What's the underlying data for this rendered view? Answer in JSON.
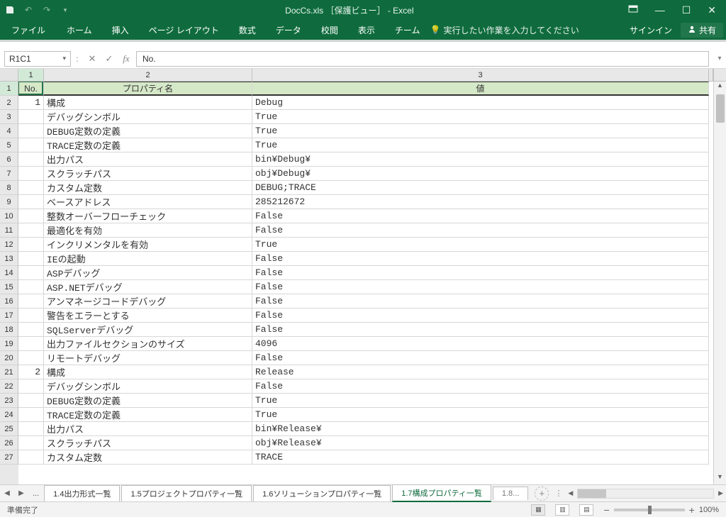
{
  "title": "DocCs.xls ［保護ビュー］ - Excel",
  "ribbon": {
    "file": "ファイル",
    "tabs": [
      "ホーム",
      "挿入",
      "ページ レイアウト",
      "数式",
      "データ",
      "校閲",
      "表示",
      "チーム"
    ],
    "tellme": "実行したい作業を入力してください",
    "signin": "サインイン",
    "share": "共有"
  },
  "namebox": "R1C1",
  "formula": "No.",
  "colHeaders": [
    "1",
    "2",
    "3"
  ],
  "sheetHeader": {
    "c1": "No.",
    "c2": "プロパティ名",
    "c3": "値"
  },
  "rows": [
    {
      "n": "1",
      "prop": "構成",
      "val": "Debug"
    },
    {
      "n": "",
      "prop": "デバッグシンボル",
      "val": "True"
    },
    {
      "n": "",
      "prop": "DEBUG定数の定義",
      "val": "True"
    },
    {
      "n": "",
      "prop": "TRACE定数の定義",
      "val": "True"
    },
    {
      "n": "",
      "prop": "出力パス",
      "val": "bin¥Debug¥"
    },
    {
      "n": "",
      "prop": "スクラッチパス",
      "val": "obj¥Debug¥"
    },
    {
      "n": "",
      "prop": "カスタム定数",
      "val": "DEBUG;TRACE"
    },
    {
      "n": "",
      "prop": "ベースアドレス",
      "val": "285212672"
    },
    {
      "n": "",
      "prop": "整数オーバーフローチェック",
      "val": "False"
    },
    {
      "n": "",
      "prop": "最適化を有効",
      "val": "False"
    },
    {
      "n": "",
      "prop": "インクリメンタルを有効",
      "val": "True"
    },
    {
      "n": "",
      "prop": "IEの起動",
      "val": "False"
    },
    {
      "n": "",
      "prop": "ASPデバッグ",
      "val": "False"
    },
    {
      "n": "",
      "prop": "ASP.NETデバッグ",
      "val": "False"
    },
    {
      "n": "",
      "prop": "アンマネージコードデバッグ",
      "val": "False"
    },
    {
      "n": "",
      "prop": "警告をエラーとする",
      "val": "False"
    },
    {
      "n": "",
      "prop": "SQLServerデバッグ",
      "val": "False"
    },
    {
      "n": "",
      "prop": "出力ファイルセクションのサイズ",
      "val": "4096"
    },
    {
      "n": "",
      "prop": "リモートデバッグ",
      "val": "False"
    },
    {
      "n": "2",
      "prop": "構成",
      "val": "Release"
    },
    {
      "n": "",
      "prop": "デバッグシンボル",
      "val": "False"
    },
    {
      "n": "",
      "prop": "DEBUG定数の定義",
      "val": "True"
    },
    {
      "n": "",
      "prop": "TRACE定数の定義",
      "val": "True"
    },
    {
      "n": "",
      "prop": "出力パス",
      "val": "bin¥Release¥"
    },
    {
      "n": "",
      "prop": "スクラッチパス",
      "val": "obj¥Release¥"
    },
    {
      "n": "",
      "prop": "カスタム定数",
      "val": "TRACE"
    }
  ],
  "sheetTabs": {
    "prevEllipsis": "...",
    "tabs": [
      "1.4出力形式一覧",
      "1.5プロジェクトプロパティ一覧",
      "1.6ソリューションプロパティ一覧",
      "1.7構成プロパティ一覧"
    ],
    "activeIndex": 3,
    "nextTrunc": "1.8..."
  },
  "status": {
    "ready": "準備完了",
    "zoom": "100%"
  }
}
